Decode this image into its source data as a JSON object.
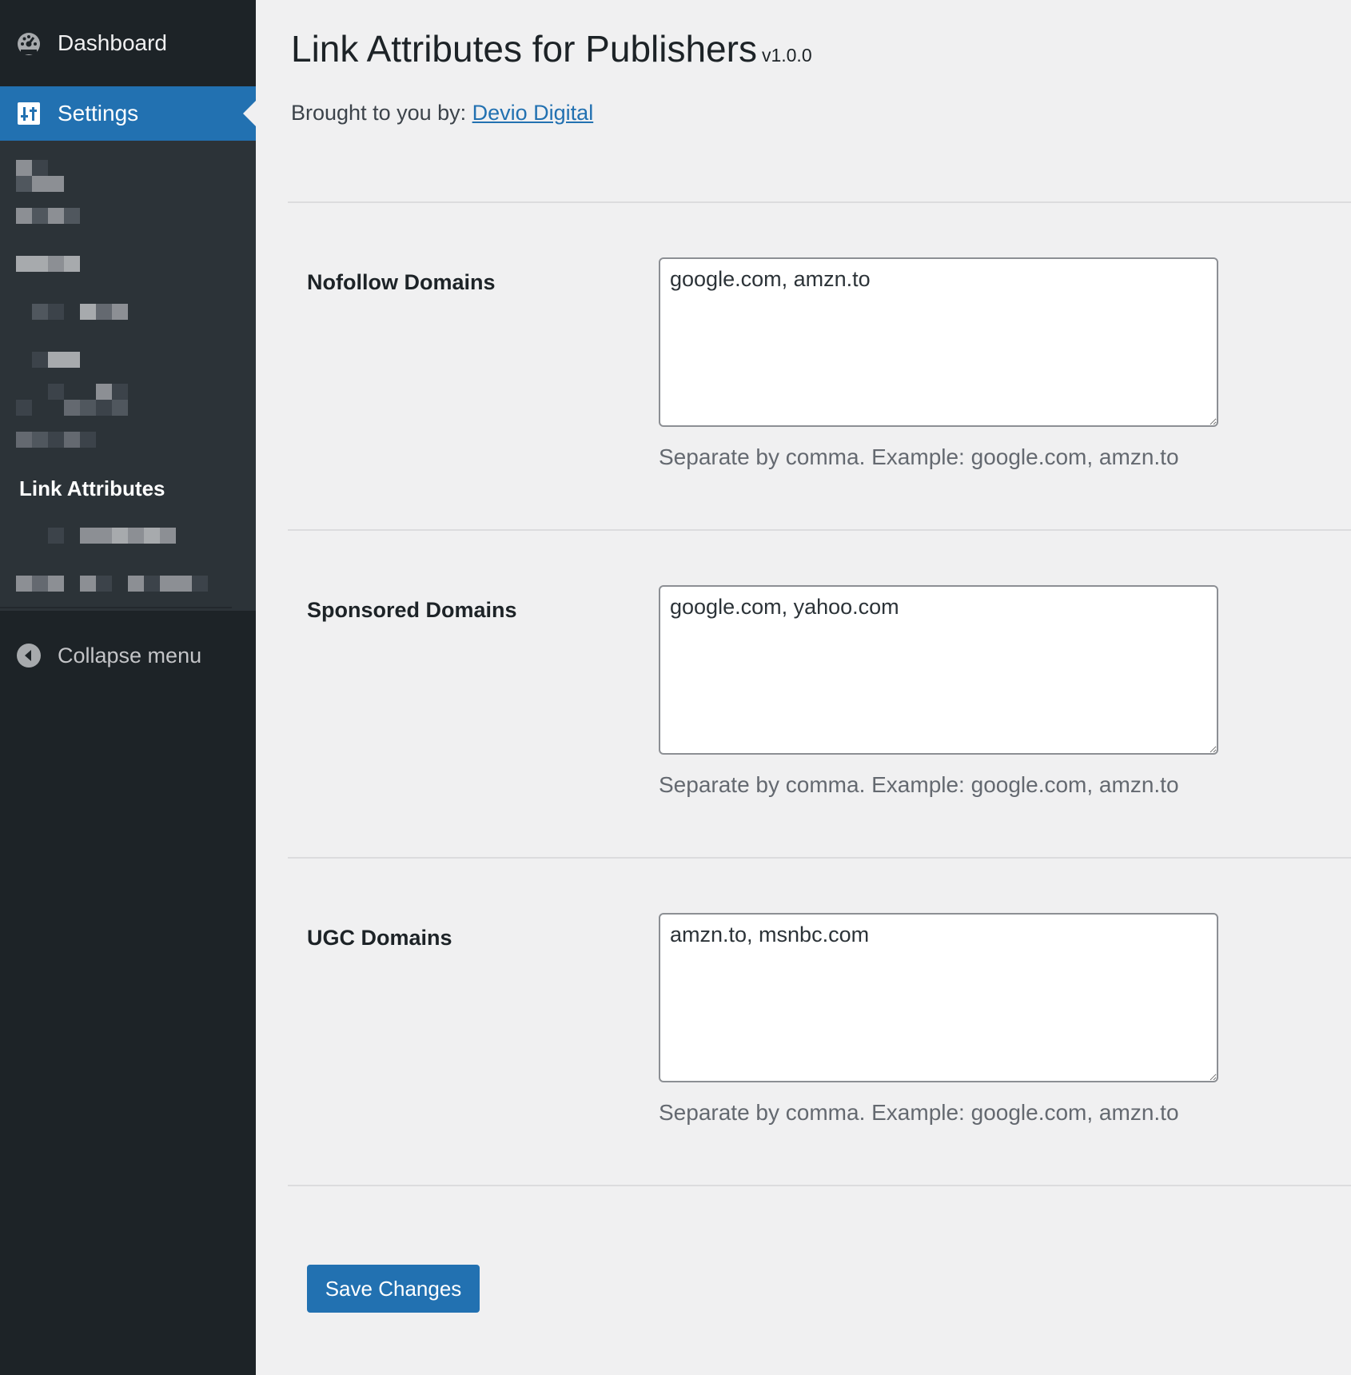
{
  "sidebar": {
    "dashboard": {
      "label": "Dashboard",
      "icon": "dashboard-icon"
    },
    "settings": {
      "label": "Settings",
      "icon": "settings-icon"
    },
    "submenu_current": "Link Attributes",
    "collapse": {
      "label": "Collapse menu",
      "icon": "collapse-arrow-icon"
    }
  },
  "page": {
    "title": "Link Attributes for Publishers",
    "version": "v1.0.0",
    "byline_prefix": "Brought to you by: ",
    "byline_link": "Devio Digital"
  },
  "fields": [
    {
      "label": "Nofollow Domains",
      "value": "google.com, amzn.to",
      "description": "Separate by comma. Example: google.com, amzn.to"
    },
    {
      "label": "Sponsored Domains",
      "value": "google.com, yahoo.com",
      "description": "Separate by comma. Example: google.com, amzn.to"
    },
    {
      "label": "UGC Domains",
      "value": "amzn.to, msnbc.com",
      "description": "Separate by comma. Example: google.com, amzn.to"
    }
  ],
  "save_button": "Save Changes",
  "colors": {
    "sidebar_bg": "#1d2327",
    "submenu_bg": "#2c3338",
    "accent": "#2271b1",
    "page_bg": "#f0f0f1"
  }
}
